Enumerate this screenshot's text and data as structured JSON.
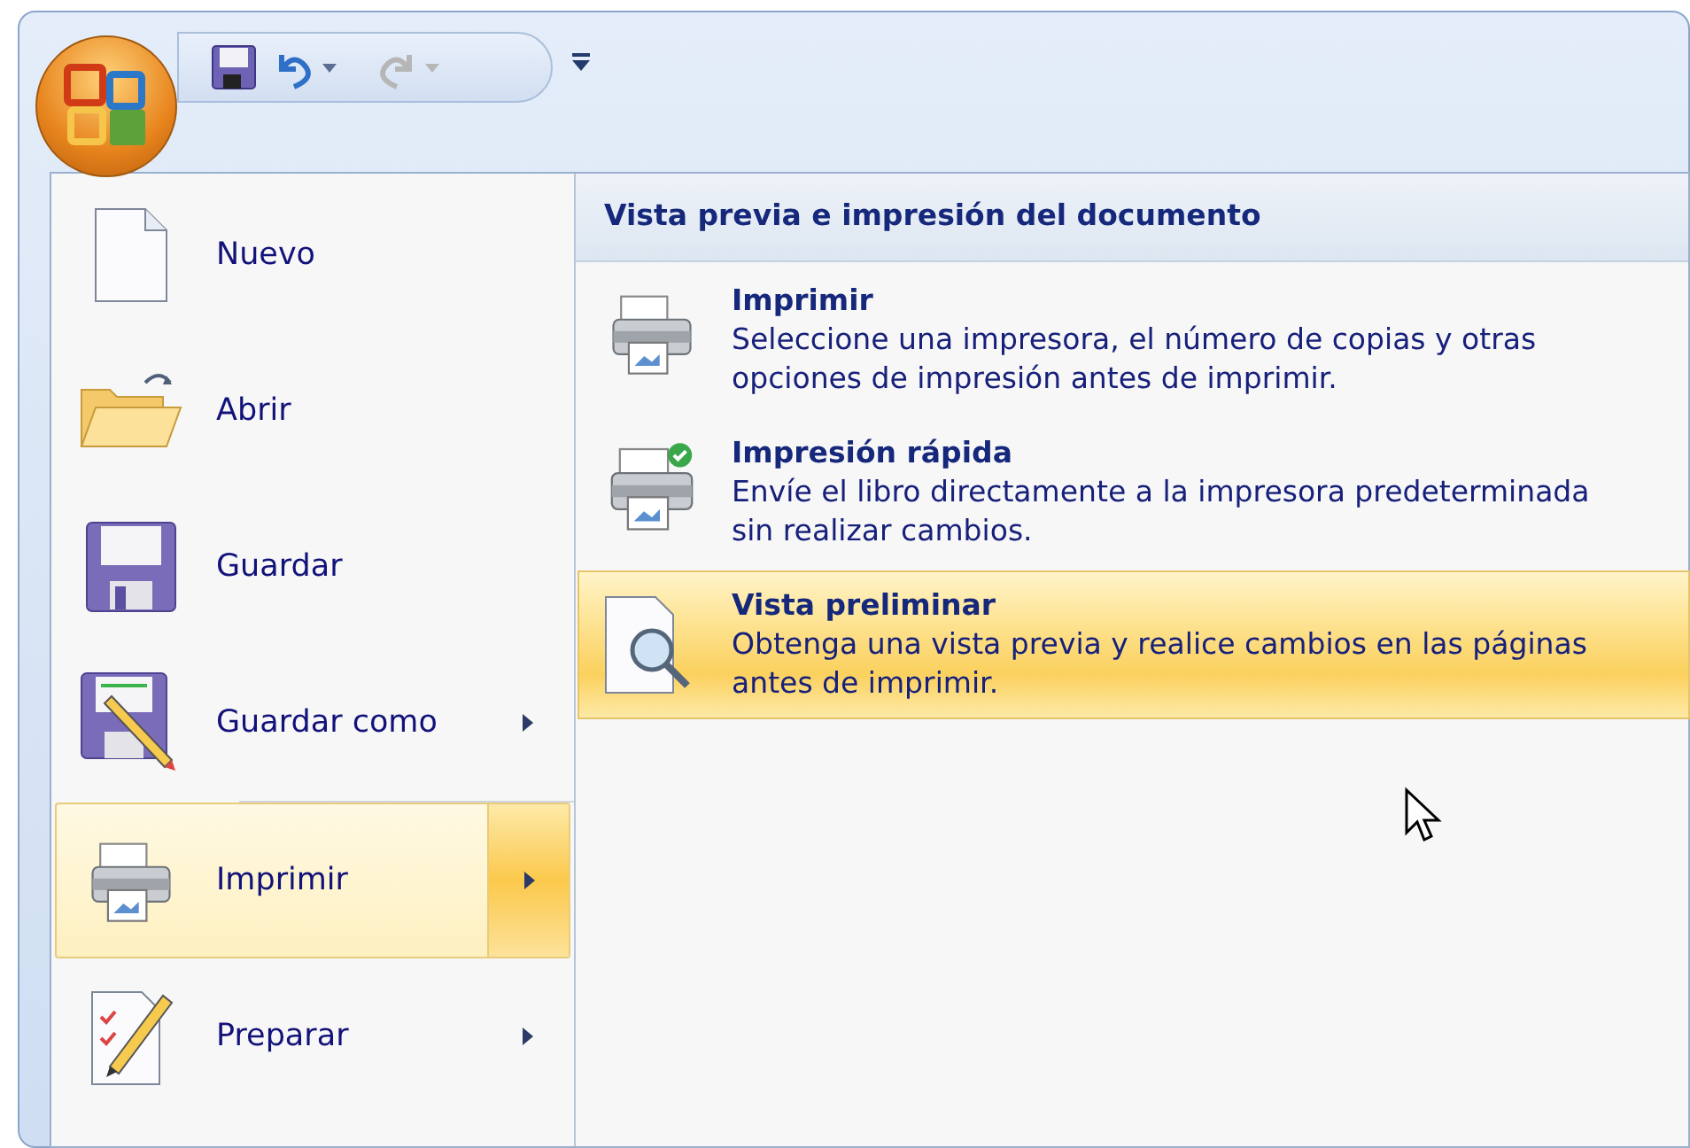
{
  "quick_access": {
    "buttons": [
      {
        "kind": "save",
        "disabled": false
      },
      {
        "kind": "undo",
        "disabled": false
      },
      {
        "kind": "redo",
        "disabled": true
      }
    ]
  },
  "menu": {
    "items": [
      {
        "kind": "new",
        "label": "Nuevo",
        "submenu": false,
        "selected": false
      },
      {
        "kind": "open",
        "label": "Abrir",
        "submenu": false,
        "selected": false
      },
      {
        "kind": "save",
        "label": "Guardar",
        "submenu": false,
        "selected": false
      },
      {
        "kind": "saveas",
        "label": "Guardar como",
        "submenu": true,
        "selected": false
      },
      {
        "kind": "print",
        "label": "Imprimir",
        "submenu": true,
        "selected": true
      },
      {
        "kind": "prepare",
        "label": "Preparar",
        "submenu": true,
        "selected": false
      }
    ]
  },
  "submenu": {
    "heading": "Vista previa e impresión del documento",
    "items": [
      {
        "kind": "print",
        "title": "Imprimir",
        "description": "Seleccione una impresora, el número de copias y otras opciones de impresión antes de imprimir.",
        "selected": false
      },
      {
        "kind": "quickprint",
        "title": "Impresión rápida",
        "description": "Envíe el libro directamente a la impresora predeterminada sin realizar cambios.",
        "selected": false
      },
      {
        "kind": "preview",
        "title": "Vista preliminar",
        "description": "Obtenga una vista previa y realice cambios en las páginas antes de imprimir.",
        "selected": true
      }
    ]
  }
}
